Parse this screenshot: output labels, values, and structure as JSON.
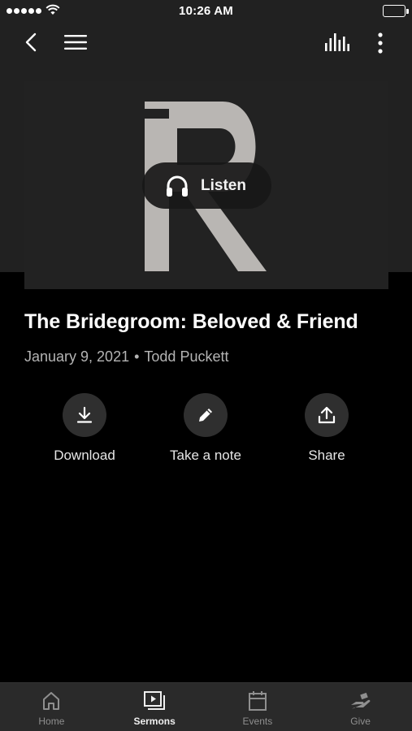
{
  "status_bar": {
    "time": "10:26 AM"
  },
  "sermon": {
    "title": "The Bridegroom: Beloved & Friend",
    "date": "January 9, 2021",
    "separator": "•",
    "speaker": "Todd Puckett",
    "listen_label": "Listen"
  },
  "actions": [
    {
      "label": "Download",
      "icon": "download-icon"
    },
    {
      "label": "Take a note",
      "icon": "pencil-icon"
    },
    {
      "label": "Share",
      "icon": "share-icon"
    }
  ],
  "tabs": [
    {
      "label": "Home",
      "icon": "home-icon",
      "active": false
    },
    {
      "label": "Sermons",
      "icon": "sermons-icon",
      "active": true
    },
    {
      "label": "Events",
      "icon": "calendar-icon",
      "active": false
    },
    {
      "label": "Give",
      "icon": "give-icon",
      "active": false
    }
  ],
  "colors": {
    "background": "#000000",
    "hero": "#212121",
    "tabbar": "#2a2a2a",
    "logo": "#b9b6b3"
  }
}
